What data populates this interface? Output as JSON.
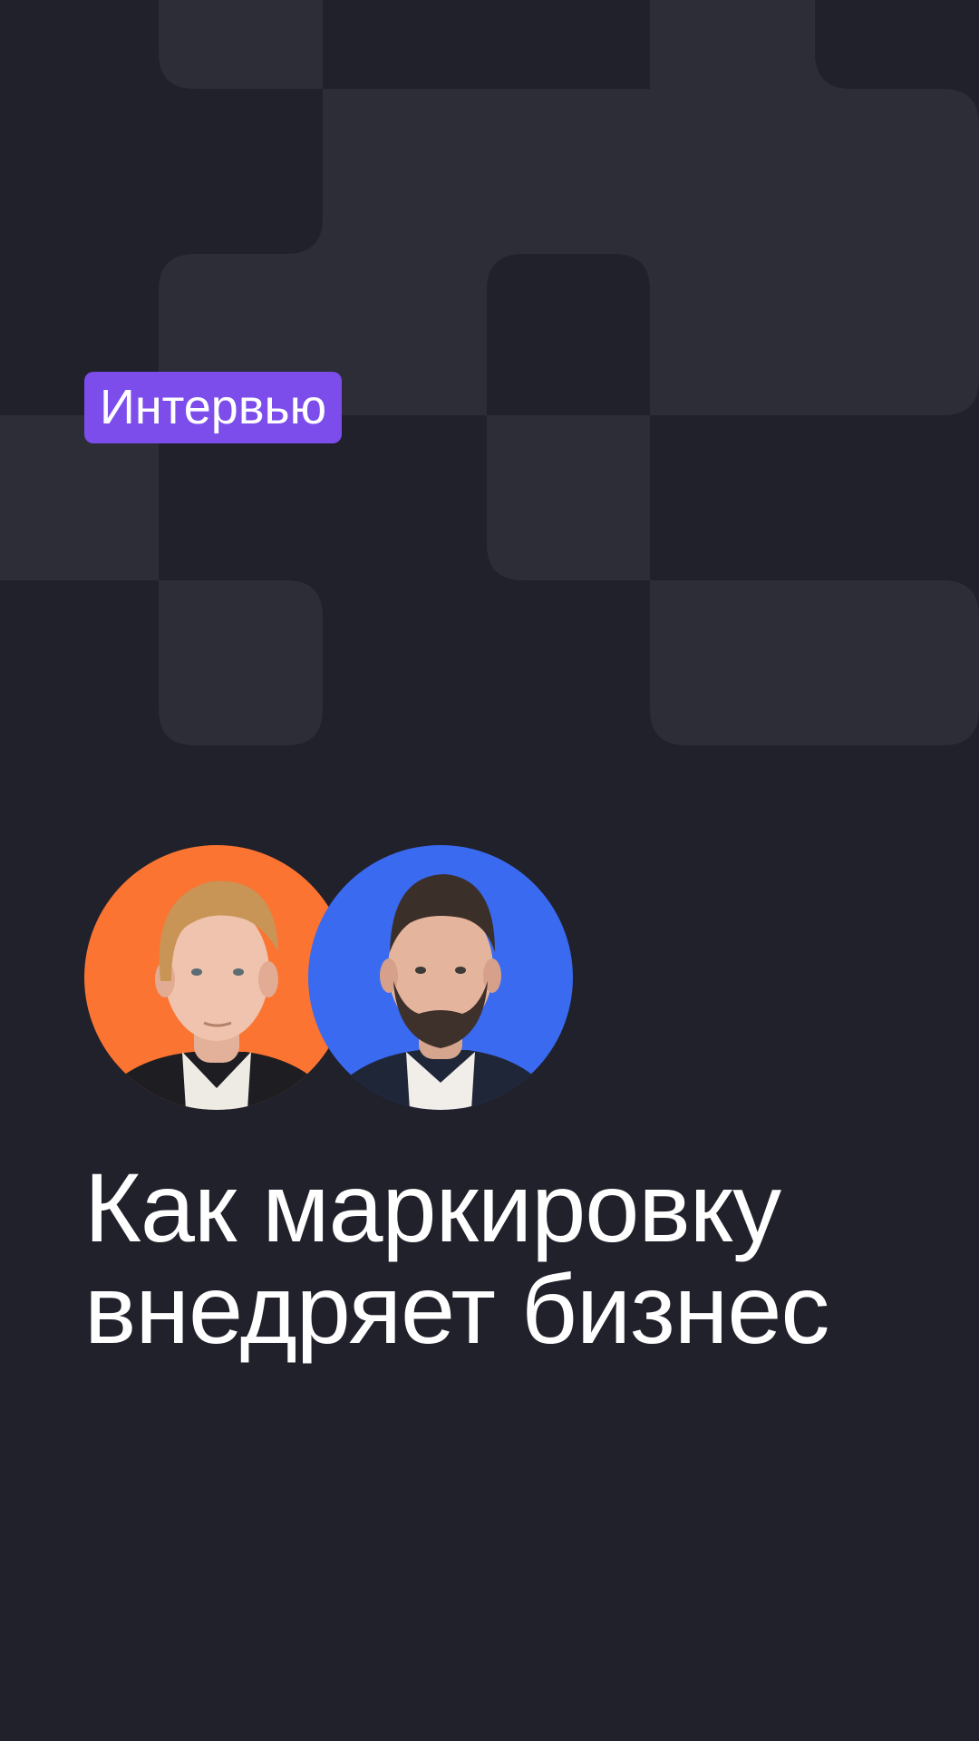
{
  "tag": {
    "label": "Интервью",
    "color": "#7c4deb"
  },
  "avatars": [
    {
      "icon": "person-portrait-icon",
      "background": "#fb7432",
      "hair": "#c89557"
    },
    {
      "icon": "person-portrait-icon",
      "background": "#3a6af0",
      "hair": "#3b2f29"
    }
  ],
  "headline": {
    "line1": "Как маркировку",
    "line2": "внедряет бизнес"
  },
  "colors": {
    "background": "#20212b",
    "pattern": "#2c2d37",
    "text": "#ffffff"
  }
}
